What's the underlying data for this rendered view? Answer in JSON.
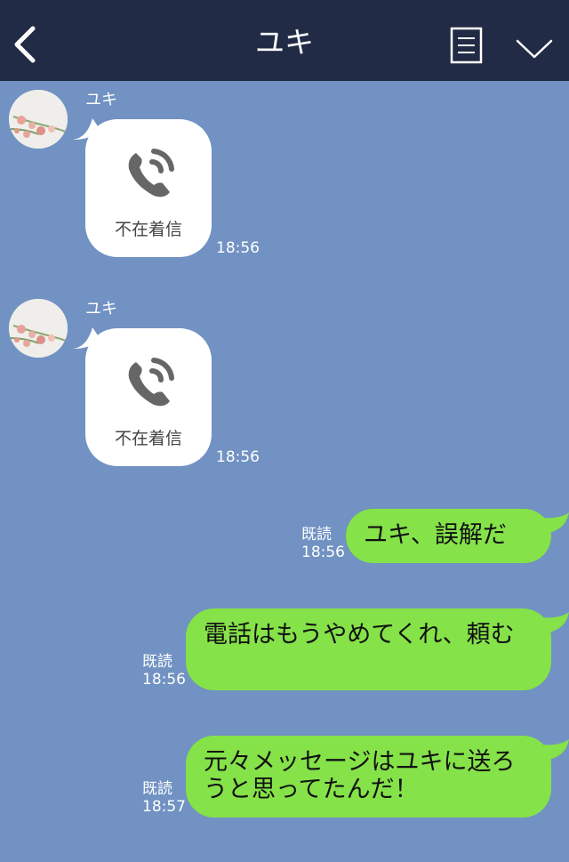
{
  "header": {
    "title": "ユキ",
    "back_icon": "chevron-left-icon",
    "menu_icon": "document-menu-icon",
    "expand_icon": "chevron-down-icon",
    "bg_color": "#222b45"
  },
  "chat_bg_color": "#7192c2",
  "incoming": [
    {
      "sender": "ユキ",
      "label": "不在着信",
      "time": "18:56",
      "icon": "missed-call-phone-icon"
    },
    {
      "sender": "ユキ",
      "label": "不在着信",
      "time": "18:56",
      "icon": "missed-call-phone-icon"
    }
  ],
  "outgoing": [
    {
      "read": "既読",
      "time": "18:56",
      "text": "ユキ、誤解だ"
    },
    {
      "read": "既読",
      "time": "18:56",
      "text": "電話はもうやめてくれ、頼む"
    },
    {
      "read": "既読",
      "time": "18:57",
      "text": "元々メッセージはユキに送ろうと思ってたんだ！"
    }
  ],
  "colors": {
    "outgoing_bubble": "#85e249",
    "incoming_bubble": "#ffffff"
  }
}
